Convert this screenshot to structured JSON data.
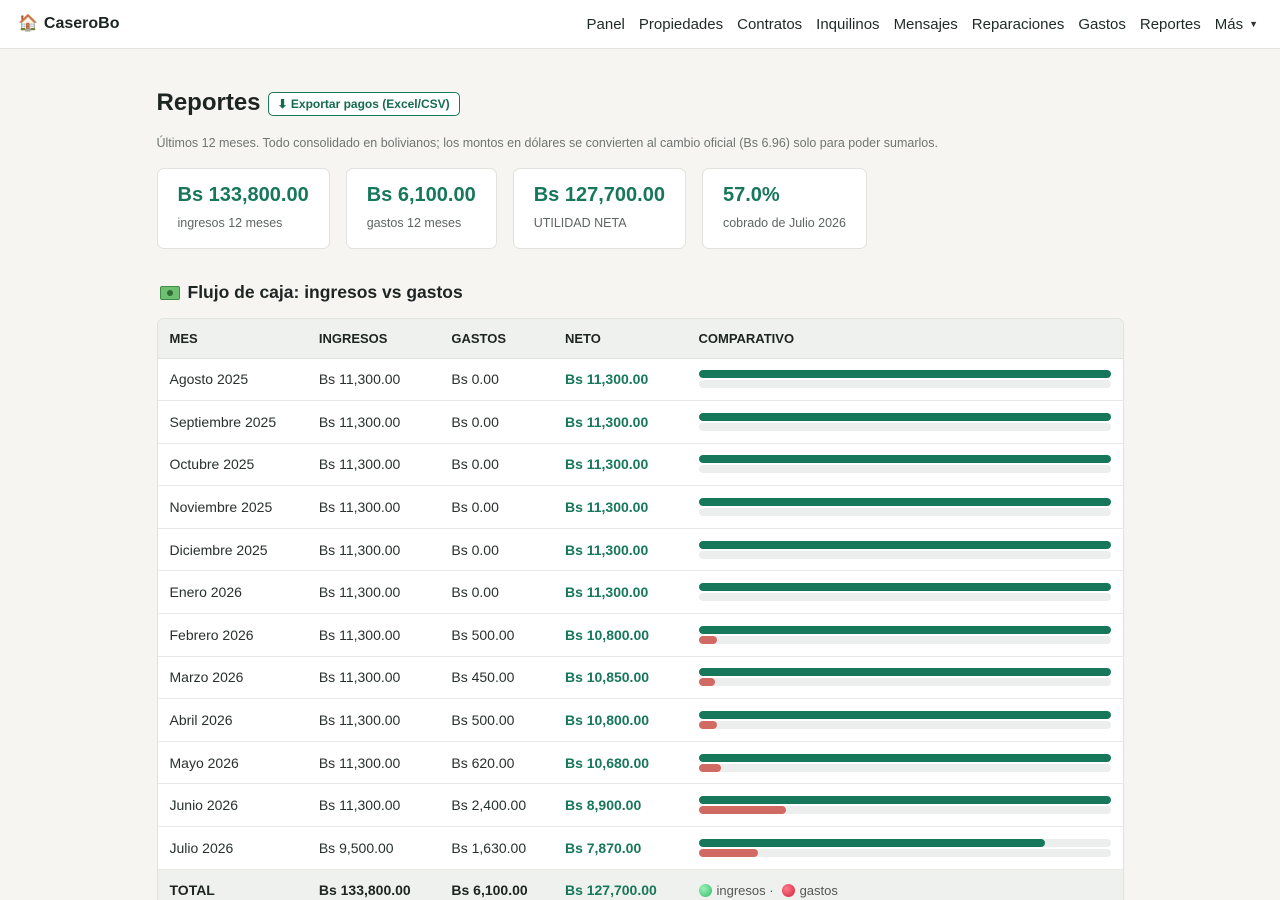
{
  "app": {
    "brand": "CaseroBo",
    "brand_icon": "house-icon"
  },
  "nav": {
    "items": [
      "Panel",
      "Propiedades",
      "Contratos",
      "Inquilinos",
      "Mensajes",
      "Reparaciones",
      "Gastos",
      "Reportes"
    ],
    "more": "Más"
  },
  "page": {
    "title": "Reportes",
    "export_label": "⬇ Exportar pagos (Excel/CSV)",
    "subtitle": "Últimos 12 meses. Todo consolidado en bolivianos; los montos en dólares se convierten al cambio oficial (Bs 6.96) solo para poder sumarlos."
  },
  "kpis": [
    {
      "value": "Bs 133,800.00",
      "label": "ingresos 12 meses"
    },
    {
      "value": "Bs 6,100.00",
      "label": "gastos 12 meses"
    },
    {
      "value": "Bs 127,700.00",
      "label": "UTILIDAD NETA"
    },
    {
      "value": "57.0%",
      "label": "cobrado de Julio 2026"
    }
  ],
  "cashflow": {
    "title": "Flujo de caja: ingresos vs gastos",
    "icon": "money-icon",
    "headers": [
      "MES",
      "INGRESOS",
      "GASTOS",
      "NETO",
      "COMPARATIVO"
    ],
    "scale_max": 11300,
    "rows": [
      {
        "mes": "Agosto 2025",
        "ingresos": "Bs 11,300.00",
        "gastos": "Bs 0.00",
        "neto": "Bs 11,300.00",
        "ing_val": 11300,
        "gas_val": 0
      },
      {
        "mes": "Septiembre 2025",
        "ingresos": "Bs 11,300.00",
        "gastos": "Bs 0.00",
        "neto": "Bs 11,300.00",
        "ing_val": 11300,
        "gas_val": 0
      },
      {
        "mes": "Octubre 2025",
        "ingresos": "Bs 11,300.00",
        "gastos": "Bs 0.00",
        "neto": "Bs 11,300.00",
        "ing_val": 11300,
        "gas_val": 0
      },
      {
        "mes": "Noviembre 2025",
        "ingresos": "Bs 11,300.00",
        "gastos": "Bs 0.00",
        "neto": "Bs 11,300.00",
        "ing_val": 11300,
        "gas_val": 0
      },
      {
        "mes": "Diciembre 2025",
        "ingresos": "Bs 11,300.00",
        "gastos": "Bs 0.00",
        "neto": "Bs 11,300.00",
        "ing_val": 11300,
        "gas_val": 0
      },
      {
        "mes": "Enero 2026",
        "ingresos": "Bs 11,300.00",
        "gastos": "Bs 0.00",
        "neto": "Bs 11,300.00",
        "ing_val": 11300,
        "gas_val": 0
      },
      {
        "mes": "Febrero 2026",
        "ingresos": "Bs 11,300.00",
        "gastos": "Bs 500.00",
        "neto": "Bs 10,800.00",
        "ing_val": 11300,
        "gas_val": 500
      },
      {
        "mes": "Marzo 2026",
        "ingresos": "Bs 11,300.00",
        "gastos": "Bs 450.00",
        "neto": "Bs 10,850.00",
        "ing_val": 11300,
        "gas_val": 450
      },
      {
        "mes": "Abril 2026",
        "ingresos": "Bs 11,300.00",
        "gastos": "Bs 500.00",
        "neto": "Bs 10,800.00",
        "ing_val": 11300,
        "gas_val": 500
      },
      {
        "mes": "Mayo 2026",
        "ingresos": "Bs 11,300.00",
        "gastos": "Bs 620.00",
        "neto": "Bs 10,680.00",
        "ing_val": 11300,
        "gas_val": 620
      },
      {
        "mes": "Junio 2026",
        "ingresos": "Bs 11,300.00",
        "gastos": "Bs 2,400.00",
        "neto": "Bs 8,900.00",
        "ing_val": 11300,
        "gas_val": 2400
      },
      {
        "mes": "Julio 2026",
        "ingresos": "Bs 9,500.00",
        "gastos": "Bs 1,630.00",
        "neto": "Bs 7,870.00",
        "ing_val": 9500,
        "gas_val": 1630
      }
    ],
    "total": {
      "label": "TOTAL",
      "ingresos": "Bs 133,800.00",
      "gastos": "Bs 6,100.00",
      "neto": "Bs 127,700.00"
    },
    "legend": {
      "ingresos": "ingresos ·",
      "gastos": "gastos"
    },
    "colors": {
      "ingresos": "#17775a",
      "gastos": "#d16a62",
      "neto": "#17775a"
    }
  }
}
